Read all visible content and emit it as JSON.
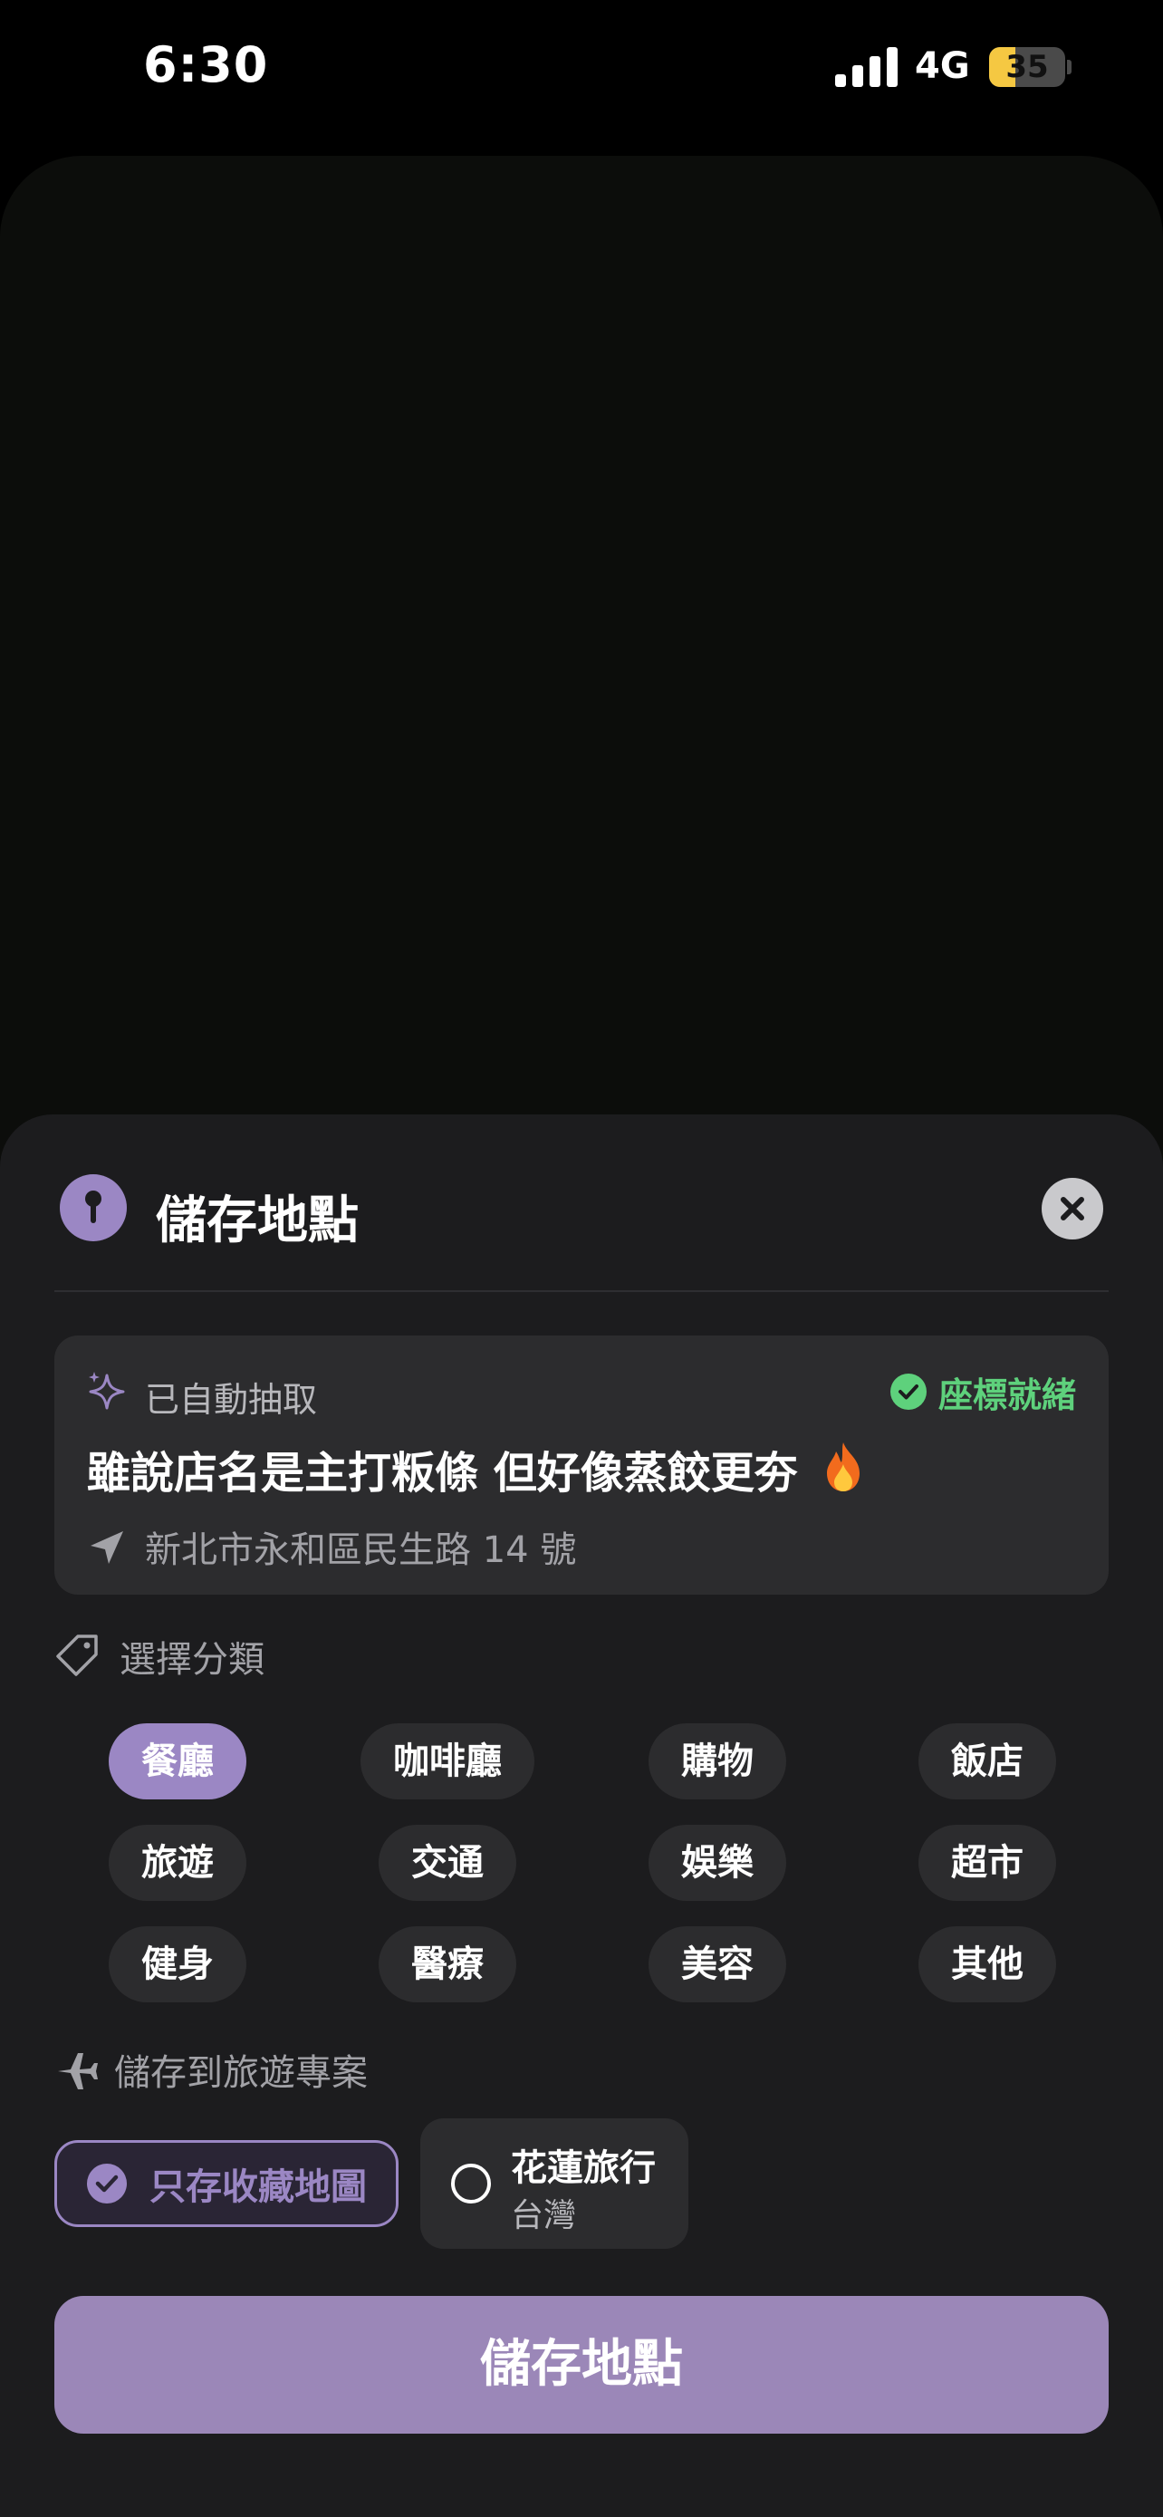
{
  "status_bar": {
    "time": "6:30",
    "network": "4G",
    "battery": "35",
    "battery_level": 0.35
  },
  "sheet": {
    "title": "儲存地點",
    "header_icon": "pin-icon",
    "close_icon": "close-icon"
  },
  "extracted": {
    "label": "已自動抽取",
    "status": "座標就緒",
    "place_name": "雖說店名是主打粄條 但好像蒸餃更夯",
    "place_emoji": "fire-icon",
    "address": "新北市永和區民生路 14 號"
  },
  "category": {
    "label": "選擇分類",
    "items": [
      {
        "label": "餐廳",
        "selected": true
      },
      {
        "label": "咖啡廳",
        "selected": false
      },
      {
        "label": "購物",
        "selected": false
      },
      {
        "label": "飯店",
        "selected": false
      },
      {
        "label": "旅遊",
        "selected": false
      },
      {
        "label": "交通",
        "selected": false
      },
      {
        "label": "娛樂",
        "selected": false
      },
      {
        "label": "超市",
        "selected": false
      },
      {
        "label": "健身",
        "selected": false
      },
      {
        "label": "醫療",
        "selected": false
      },
      {
        "label": "美容",
        "selected": false
      },
      {
        "label": "其他",
        "selected": false
      }
    ]
  },
  "trip": {
    "label": "儲存到旅遊專案",
    "favorite_only": "只存收藏地圖",
    "project_name": "花蓮旅行",
    "project_region": "台灣"
  },
  "save_label": "儲存地點",
  "colors": {
    "accent": "#9b87c4",
    "success": "#5ed17c",
    "sheet_bg": "#1c1c1e",
    "card_bg": "#2c2c2e",
    "battery": "#f5c842"
  }
}
